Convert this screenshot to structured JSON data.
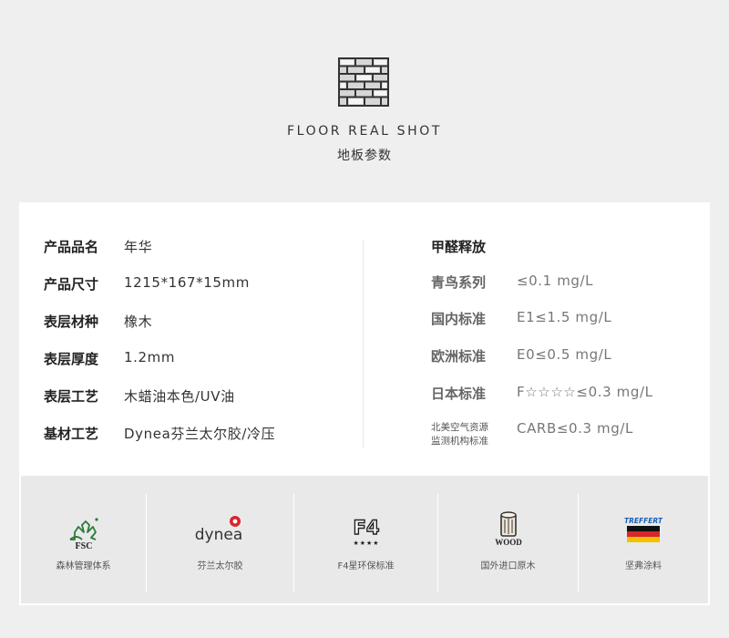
{
  "header": {
    "icon": "brick-floor-icon",
    "title_en": "FLOOR REAL SHOT",
    "title_cn": "地板参数"
  },
  "specs": [
    {
      "label": "产品品名",
      "value": "年华"
    },
    {
      "label": "产品尺寸",
      "value": "1215*167*15mm"
    },
    {
      "label": "表层材种",
      "value": "橡木"
    },
    {
      "label": "表层厚度",
      "value": "1.2mm"
    },
    {
      "label": "表层工艺",
      "value": "木蜡油本色/UV油"
    },
    {
      "label": "基材工艺",
      "value": "Dynea芬兰太尔胶/冷压"
    }
  ],
  "formaldehyde": {
    "title": "甲醛释放",
    "rows": [
      {
        "label": "青鸟系列",
        "value": "≤0.1 mg/L"
      },
      {
        "label": "国内标准",
        "value": "E1≤1.5 mg/L"
      },
      {
        "label": "欧洲标准",
        "value": "E0≤0.5 mg/L"
      },
      {
        "label": "日本标准",
        "value": "F☆☆☆☆≤0.3 mg/L"
      },
      {
        "label_line1": "北美空气资源",
        "label_line2": "监测机构标准",
        "value": "CARB≤0.3 mg/L"
      }
    ]
  },
  "badges": [
    {
      "icon": "fsc-tree-icon",
      "logo_text": "FSC",
      "caption": "森林管理体系"
    },
    {
      "icon": "dynea-logo-icon",
      "logo_text": "dynea",
      "caption": "芬兰太尔胶"
    },
    {
      "icon": "f4-stars-icon",
      "logo_text": "F4",
      "stars": "★★★★",
      "caption": "F4星环保标准"
    },
    {
      "icon": "wood-log-icon",
      "logo_text": "WOOD",
      "caption": "国外进口原木"
    },
    {
      "icon": "treffert-flag-icon",
      "logo_text": "TREFFERT",
      "caption": "坚弗涂料"
    }
  ],
  "colors": {
    "background": "#efefef",
    "card": "#ffffff",
    "badge_strip": "#e9e9e9",
    "dynea_red": "#d9262c",
    "flag_black": "#111111",
    "flag_red": "#d9262c",
    "flag_gold": "#f2c200",
    "treffert_blue": "#1a5fb4"
  }
}
